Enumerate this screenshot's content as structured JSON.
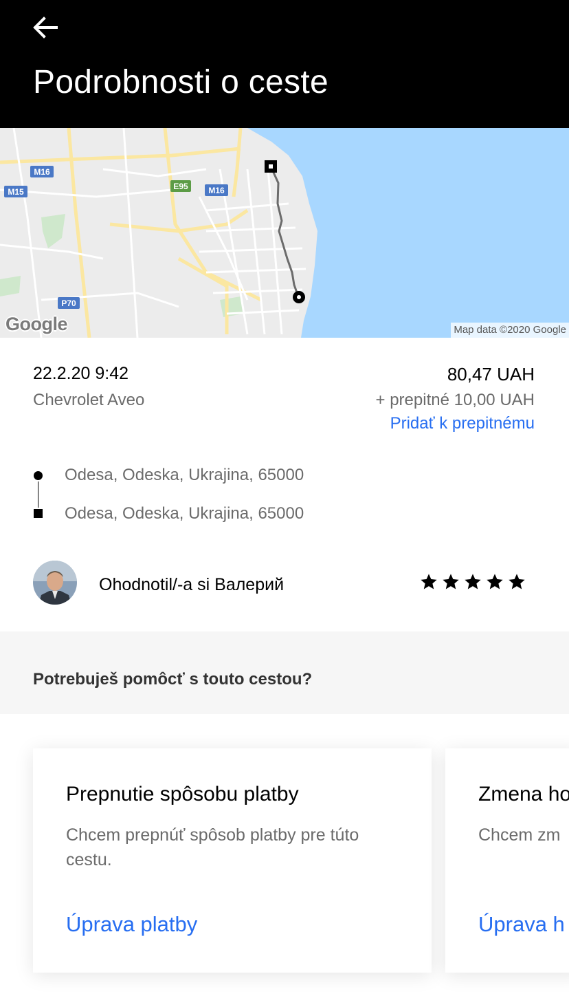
{
  "header": {
    "back_icon": "arrow-left-icon",
    "title": "Podrobnosti o ceste"
  },
  "map": {
    "attribution": "Map data ©2020 Google",
    "logo_text": "Google",
    "road_labels": [
      "M16",
      "M15",
      "E95",
      "M16",
      "P70"
    ],
    "water_color": "#a8d7ff",
    "route_color": "#6b6b6b"
  },
  "trip": {
    "date": "22.2.20 9:42",
    "vehicle": "Chevrolet Aveo",
    "fare": "80,47 UAH",
    "tip": "+ prepitné 10,00 UAH",
    "add_tip_label": "Pridať k prepitnému"
  },
  "route": {
    "pickup": "Odesa, Odeska, Ukrajina, 65000",
    "dropoff": "Odesa, Odeska, Ukrajina, 65000"
  },
  "rating": {
    "prefix": "Ohodnotil/-a si ",
    "driver_name": "Валерий",
    "stars": 5,
    "star_icon": "star-icon"
  },
  "help": {
    "title": "Potrebuješ pomôcť s touto cestou?",
    "cards": [
      {
        "title": "Prepnutie spôsobu platby",
        "description": "Chcem prepnúť spôsob platby pre túto cestu.",
        "link": "Úprava platby"
      },
      {
        "title": "Zmena ho",
        "description": "Chcem zm",
        "link": "Úprava h"
      }
    ]
  },
  "colors": {
    "accent": "#276ef1",
    "header_bg": "#000000",
    "secondary_text": "#6b6b6b"
  }
}
